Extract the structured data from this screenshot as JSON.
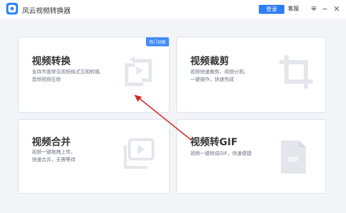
{
  "app": {
    "title": "风云视频转换器",
    "login_label": "登录",
    "service_label": "客服",
    "controls": {
      "menu_icon": "menu-icon",
      "minimize_icon": "minimize-icon",
      "close_icon": "close-icon"
    }
  },
  "cards": [
    {
      "title": "视频转换",
      "desc": [
        "支持市面常见视频格式互相转换,",
        "音频视频互转"
      ],
      "badge": "热门功能",
      "icon": "convert-icon"
    },
    {
      "title": "视频裁剪",
      "desc": [
        "视频快速裁剪、视频分割、",
        "一键操作，快速完成"
      ],
      "icon": "crop-icon"
    },
    {
      "title": "视频合并",
      "desc": [
        "视频一键拖拽上传，",
        "快速合并，无需等待"
      ],
      "icon": "merge-icon"
    },
    {
      "title": "视频转GIF",
      "desc": [
        "视频一键转成GIF，快速便捷"
      ],
      "icon": "gif-file-icon",
      "icon_text": "GIF"
    }
  ],
  "colors": {
    "accent": "#2f7df6",
    "arrow": "#d42a2a",
    "icon_gray": "#e3e6eb"
  }
}
